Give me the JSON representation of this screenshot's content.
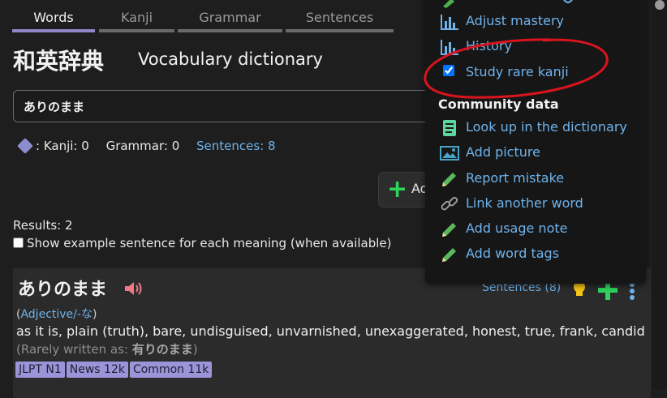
{
  "tabs": [
    {
      "label": "Words",
      "active": true
    },
    {
      "label": "Kanji",
      "active": false
    },
    {
      "label": "Grammar",
      "active": false
    },
    {
      "label": "Sentences",
      "active": false
    }
  ],
  "header": {
    "title_jp": "和英辞典",
    "title_en": "Vocabulary dictionary"
  },
  "search": {
    "value": "ありのまま"
  },
  "stats": {
    "kanji": ": Kanji: 0",
    "grammar": "Grammar: 0",
    "sentences": "Sentences: 8"
  },
  "add_button": {
    "label": "Ad"
  },
  "results": {
    "label": "Results: 2"
  },
  "show_examples": {
    "label": "Show example sentence for each meaning (when available)",
    "checked": false
  },
  "entry": {
    "word": "ありのまま",
    "pos_open": "(",
    "pos": "Adjective/-な",
    "pos_close": ")",
    "definition": "as it is, plain (truth), bare, undisguised, unvarnished, unexaggerated, honest, true, frank, candid",
    "rare_prefix": "(Rarely written as: ",
    "rare_form": "有りのまま",
    "rare_suffix": ")",
    "tags": [
      "JLPT N1",
      "News 12k",
      "Common 11k"
    ],
    "sentences_link": "Sentences (8)"
  },
  "menu": {
    "items_top": [
      {
        "label": "Adjust mastery",
        "icon": "bar-chart-icon"
      },
      {
        "label": "History",
        "icon": "bar-chart-icon"
      }
    ],
    "rare_kanji": {
      "label": "Study rare kanji",
      "checked": true
    },
    "community_heading": "Community data",
    "community_items": [
      {
        "label": "Look up in the dictionary",
        "icon": "book-icon"
      },
      {
        "label": "Add picture",
        "icon": "picture-icon"
      },
      {
        "label": "Report mistake",
        "icon": "pencil-icon"
      },
      {
        "label": "Link another word",
        "icon": "link-icon"
      },
      {
        "label": "Add usage note",
        "icon": "pencil-icon"
      },
      {
        "label": "Add word tags",
        "icon": "pencil-icon"
      }
    ]
  },
  "colors": {
    "accent": "#8e86c8",
    "link": "#6fb3ec",
    "tag": "#9c94d9",
    "add_green": "#2fd35a",
    "annotation_red": "#d9141e"
  }
}
